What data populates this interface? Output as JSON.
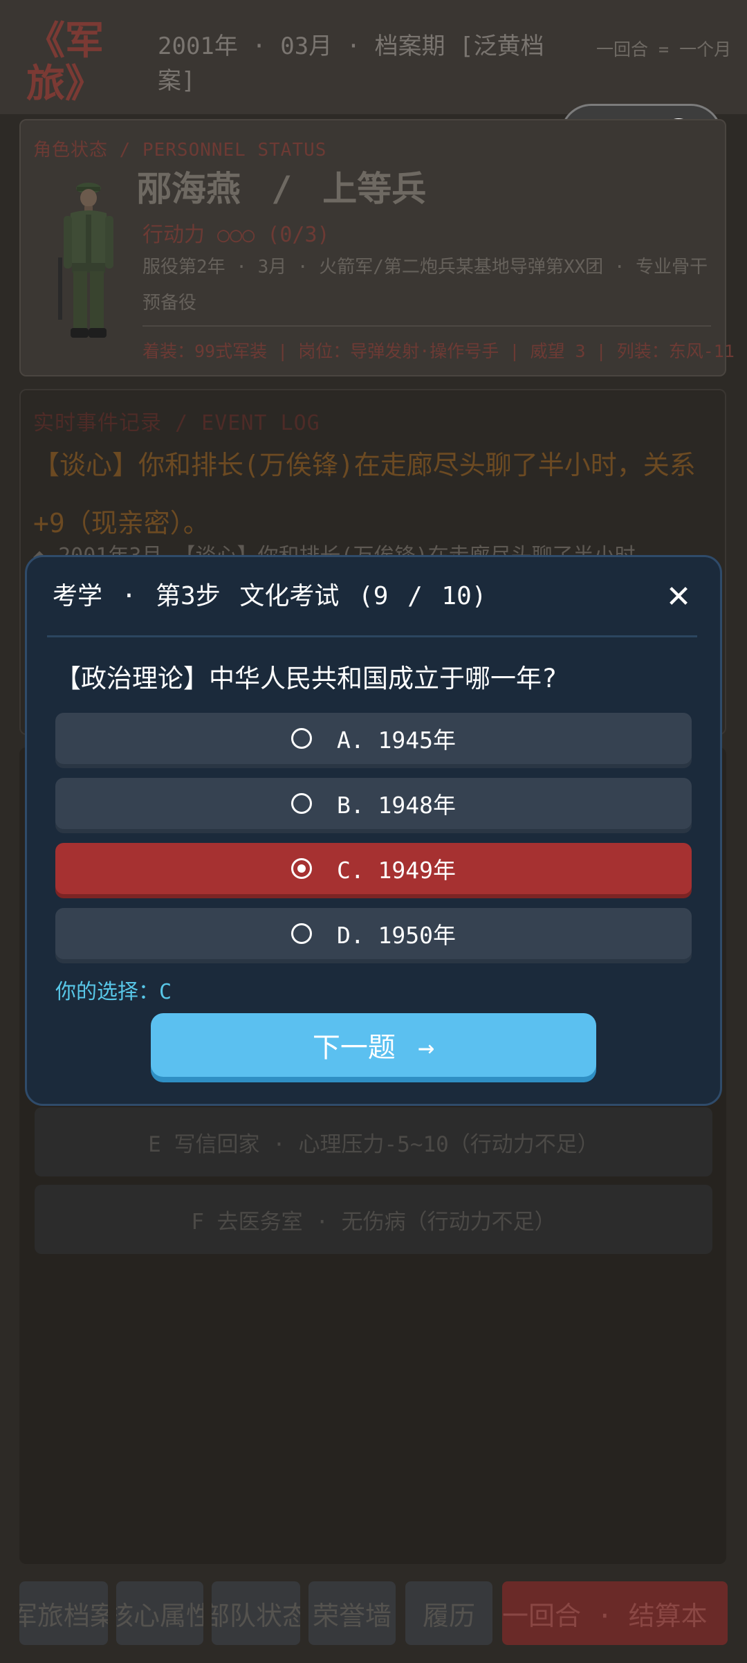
{
  "header": {
    "game_title": "《军旅》",
    "period": "2001年 · 03月 · 档案期 [泛黄档案]",
    "turn_note": "一回合 = 一个月"
  },
  "status": {
    "heading": "角色状态 / PERSONNEL STATUS",
    "name_line": "邴海燕 / 上等兵",
    "action_points": "行动力 ○○○ (0/3)",
    "service": "服役第2年 · 3月 · 火箭军/第二炮兵某基地导弹第XX团 · 专业骨干预备役",
    "equipment": "着装：99式军装 | 岗位：导弹发射·操作号手 | 威望 3 | 列装：东风-11"
  },
  "event_log": {
    "heading": "实时事件记录 / EVENT LOG",
    "headline": "【谈心】你和排长(万俟锋)在走廊尽头聊了半小时，关系+9（现亲密）。",
    "entry": "◆ 2001年3月 【谈心】你和排长(万俟锋)在走廊尽头聊了半小时"
  },
  "background_options": [
    {
      "label": "E  写信回家 · 心理压力-5~10（行动力不足）"
    },
    {
      "label": "F  去医务室 · 无伤病（行动力不足）"
    }
  ],
  "tabs": [
    {
      "label": "军旅档案"
    },
    {
      "label": "核心属性"
    },
    {
      "label": "部队状态"
    },
    {
      "label": "荣誉墙"
    },
    {
      "label": "履历"
    },
    {
      "label": "一回合 · 结算本"
    }
  ],
  "modal": {
    "title": "考学 · 第3步 文化考试 (9 / 10)",
    "close": "✕",
    "question": "【政治理论】中华人民共和国成立于哪一年?",
    "answers": [
      {
        "label": "A. 1945年",
        "selected": false
      },
      {
        "label": "B. 1948年",
        "selected": false
      },
      {
        "label": "C. 1949年",
        "selected": true
      },
      {
        "label": "D. 1950年",
        "selected": false
      }
    ],
    "selection": "你的选择：C",
    "next_button": "下一题 →"
  },
  "colors": {
    "modal_bg": "#1b2a3b",
    "selected_answer": "#a63131",
    "next_button": "#5bc0f0",
    "accent_red": "#7b3a34"
  }
}
